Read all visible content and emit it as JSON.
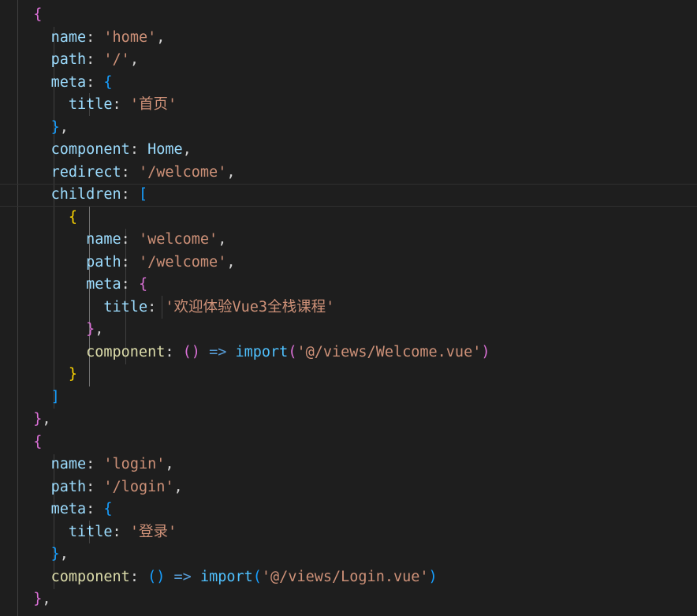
{
  "colors": {
    "background": "#1e1e1e",
    "property": "#9cdcfe",
    "string": "#ce9178",
    "punctuation": "#d4d4d4",
    "function": "#dcdcaa",
    "bracket_gold": "#ffd700",
    "bracket_magenta": "#da70d6",
    "bracket_blue": "#179fff"
  },
  "lines": [
    [
      {
        "t": "  {",
        "c": "#da70d6"
      }
    ],
    [
      {
        "t": "    "
      },
      {
        "t": "name",
        "c": "#9cdcfe"
      },
      {
        "t": ": ",
        "c": "#d4d4d4"
      },
      {
        "t": "'home'",
        "c": "#ce9178"
      },
      {
        "t": ",",
        "c": "#d4d4d4"
      }
    ],
    [
      {
        "t": "    "
      },
      {
        "t": "path",
        "c": "#9cdcfe"
      },
      {
        "t": ": ",
        "c": "#d4d4d4"
      },
      {
        "t": "'/'",
        "c": "#ce9178"
      },
      {
        "t": ",",
        "c": "#d4d4d4"
      }
    ],
    [
      {
        "t": "    "
      },
      {
        "t": "meta",
        "c": "#9cdcfe"
      },
      {
        "t": ": ",
        "c": "#d4d4d4"
      },
      {
        "t": "{",
        "c": "#179fff"
      }
    ],
    [
      {
        "t": "      "
      },
      {
        "t": "title",
        "c": "#9cdcfe"
      },
      {
        "t": ": ",
        "c": "#d4d4d4"
      },
      {
        "t": "'首页'",
        "c": "#ce9178"
      }
    ],
    [
      {
        "t": "    "
      },
      {
        "t": "}",
        "c": "#179fff"
      },
      {
        "t": ",",
        "c": "#d4d4d4"
      }
    ],
    [
      {
        "t": "    "
      },
      {
        "t": "component",
        "c": "#9cdcfe"
      },
      {
        "t": ": ",
        "c": "#d4d4d4"
      },
      {
        "t": "Home",
        "c": "#9cdcfe"
      },
      {
        "t": ",",
        "c": "#d4d4d4"
      }
    ],
    [
      {
        "t": "    "
      },
      {
        "t": "redirect",
        "c": "#9cdcfe"
      },
      {
        "t": ": ",
        "c": "#d4d4d4"
      },
      {
        "t": "'/welcome'",
        "c": "#ce9178"
      },
      {
        "t": ",",
        "c": "#d4d4d4"
      }
    ],
    [
      {
        "t": "    "
      },
      {
        "t": "children",
        "c": "#9cdcfe"
      },
      {
        "t": ": ",
        "c": "#d4d4d4"
      },
      {
        "t": "[",
        "c": "#179fff"
      }
    ],
    [
      {
        "t": "      "
      },
      {
        "t": "{",
        "c": "#ffd700"
      }
    ],
    [
      {
        "t": "        "
      },
      {
        "t": "name",
        "c": "#9cdcfe"
      },
      {
        "t": ": ",
        "c": "#d4d4d4"
      },
      {
        "t": "'welcome'",
        "c": "#ce9178"
      },
      {
        "t": ",",
        "c": "#d4d4d4"
      }
    ],
    [
      {
        "t": "        "
      },
      {
        "t": "path",
        "c": "#9cdcfe"
      },
      {
        "t": ": ",
        "c": "#d4d4d4"
      },
      {
        "t": "'/welcome'",
        "c": "#ce9178"
      },
      {
        "t": ",",
        "c": "#d4d4d4"
      }
    ],
    [
      {
        "t": "        "
      },
      {
        "t": "meta",
        "c": "#9cdcfe"
      },
      {
        "t": ": ",
        "c": "#d4d4d4"
      },
      {
        "t": "{",
        "c": "#da70d6"
      }
    ],
    [
      {
        "t": "          "
      },
      {
        "t": "title",
        "c": "#9cdcfe"
      },
      {
        "t": ": ",
        "c": "#d4d4d4"
      },
      {
        "t": "'欢迎体验Vue3全栈课程'",
        "c": "#ce9178"
      }
    ],
    [
      {
        "t": "        "
      },
      {
        "t": "}",
        "c": "#da70d6"
      },
      {
        "t": ",",
        "c": "#d4d4d4"
      }
    ],
    [
      {
        "t": "        "
      },
      {
        "t": "component",
        "c": "#dcdcaa"
      },
      {
        "t": ": ",
        "c": "#d4d4d4"
      },
      {
        "t": "()",
        "c": "#da70d6"
      },
      {
        "t": " ",
        "c": "#d4d4d4"
      },
      {
        "t": "=>",
        "c": "#569cd6"
      },
      {
        "t": " ",
        "c": "#d4d4d4"
      },
      {
        "t": "import",
        "c": "#4fc1ff"
      },
      {
        "t": "(",
        "c": "#da70d6"
      },
      {
        "t": "'@/views/Welcome.vue'",
        "c": "#ce9178"
      },
      {
        "t": ")",
        "c": "#da70d6"
      }
    ],
    [
      {
        "t": "      "
      },
      {
        "t": "}",
        "c": "#ffd700"
      }
    ],
    [
      {
        "t": "    "
      },
      {
        "t": "]",
        "c": "#179fff"
      }
    ],
    [
      {
        "t": "  "
      },
      {
        "t": "}",
        "c": "#da70d6"
      },
      {
        "t": ",",
        "c": "#d4d4d4"
      }
    ],
    [
      {
        "t": "  "
      },
      {
        "t": "{",
        "c": "#da70d6"
      }
    ],
    [
      {
        "t": "    "
      },
      {
        "t": "name",
        "c": "#9cdcfe"
      },
      {
        "t": ": ",
        "c": "#d4d4d4"
      },
      {
        "t": "'login'",
        "c": "#ce9178"
      },
      {
        "t": ",",
        "c": "#d4d4d4"
      }
    ],
    [
      {
        "t": "    "
      },
      {
        "t": "path",
        "c": "#9cdcfe"
      },
      {
        "t": ": ",
        "c": "#d4d4d4"
      },
      {
        "t": "'/login'",
        "c": "#ce9178"
      },
      {
        "t": ",",
        "c": "#d4d4d4"
      }
    ],
    [
      {
        "t": "    "
      },
      {
        "t": "meta",
        "c": "#9cdcfe"
      },
      {
        "t": ": ",
        "c": "#d4d4d4"
      },
      {
        "t": "{",
        "c": "#179fff"
      }
    ],
    [
      {
        "t": "      "
      },
      {
        "t": "title",
        "c": "#9cdcfe"
      },
      {
        "t": ": ",
        "c": "#d4d4d4"
      },
      {
        "t": "'登录'",
        "c": "#ce9178"
      }
    ],
    [
      {
        "t": "    "
      },
      {
        "t": "}",
        "c": "#179fff"
      },
      {
        "t": ",",
        "c": "#d4d4d4"
      }
    ],
    [
      {
        "t": "    "
      },
      {
        "t": "component",
        "c": "#dcdcaa"
      },
      {
        "t": ": ",
        "c": "#d4d4d4"
      },
      {
        "t": "()",
        "c": "#179fff"
      },
      {
        "t": " ",
        "c": "#d4d4d4"
      },
      {
        "t": "=>",
        "c": "#569cd6"
      },
      {
        "t": " ",
        "c": "#d4d4d4"
      },
      {
        "t": "import",
        "c": "#4fc1ff"
      },
      {
        "t": "(",
        "c": "#179fff"
      },
      {
        "t": "'@/views/Login.vue'",
        "c": "#ce9178"
      },
      {
        "t": ")",
        "c": "#179fff"
      }
    ],
    [
      {
        "t": "  "
      },
      {
        "t": "}",
        "c": "#da70d6"
      },
      {
        "t": ",",
        "c": "#d4d4d4"
      }
    ]
  ]
}
